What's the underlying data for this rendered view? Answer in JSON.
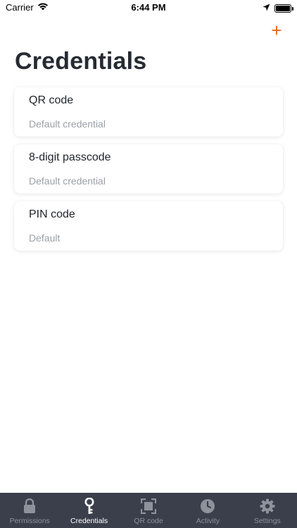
{
  "status_bar": {
    "carrier": "Carrier",
    "time": "6:44 PM",
    "battery_level": 1.0
  },
  "header": {
    "add_label": "+",
    "title": "Credentials"
  },
  "credentials": [
    {
      "name": "QR code",
      "subtitle": "Default credential"
    },
    {
      "name": "8-digit passcode",
      "subtitle": "Default credential"
    },
    {
      "name": "PIN code",
      "subtitle": "Default"
    }
  ],
  "tabs": [
    {
      "label": "Permissions",
      "icon": "lock-icon",
      "active": false
    },
    {
      "label": "Credentials",
      "icon": "key-icon",
      "active": true
    },
    {
      "label": "QR code",
      "icon": "qr-scan-icon",
      "active": false
    },
    {
      "label": "Activity",
      "icon": "clock-icon",
      "active": false
    },
    {
      "label": "Settings",
      "icon": "gear-icon",
      "active": false
    }
  ],
  "colors": {
    "accent": "#f0641e",
    "tab_bar": "#3a3f4b",
    "tab_inactive": "#8d929c",
    "tab_active": "#ffffff"
  }
}
